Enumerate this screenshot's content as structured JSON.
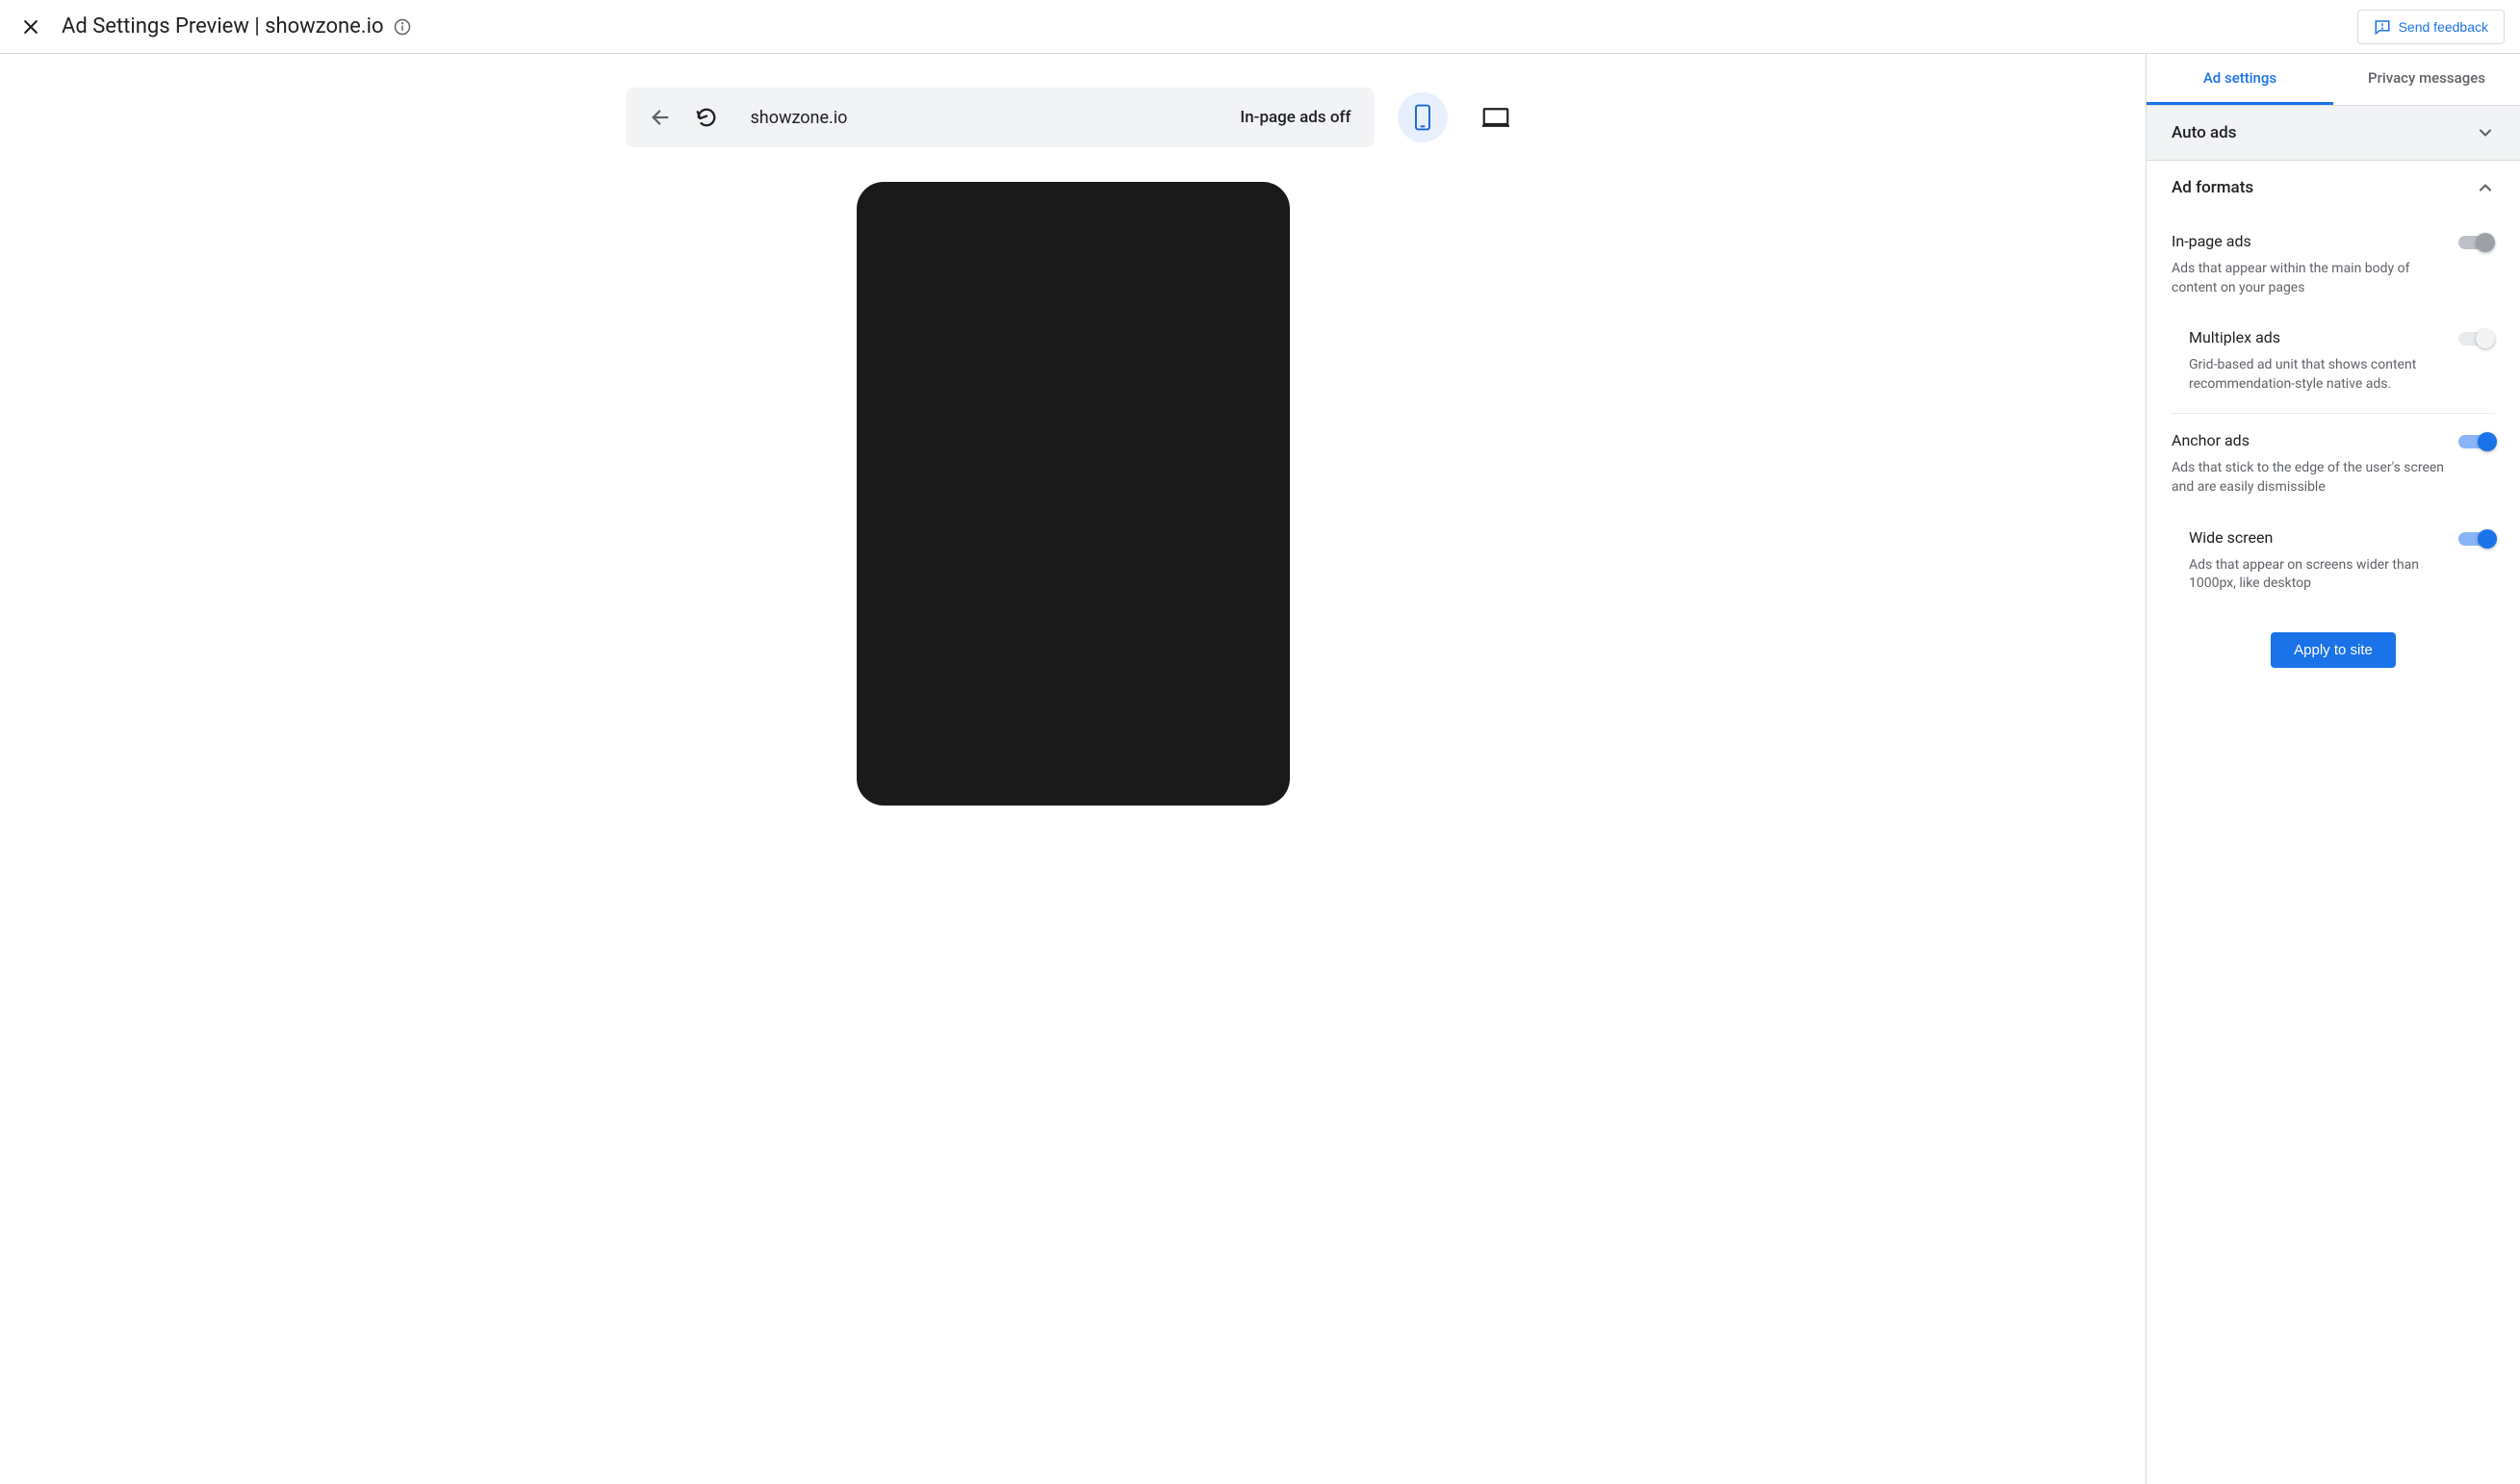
{
  "header": {
    "title": "Ad Settings Preview | showzone.io",
    "feedback_label": "Send feedback"
  },
  "preview": {
    "url": "showzone.io",
    "ads_status": "In-page ads off",
    "device_active": "mobile"
  },
  "sidebar": {
    "tabs": {
      "ad_settings": "Ad settings",
      "privacy_messages": "Privacy messages",
      "active": "ad_settings"
    },
    "auto_ads": {
      "title": "Auto ads",
      "expanded": false
    },
    "ad_formats": {
      "title": "Ad formats",
      "expanded": true,
      "in_page": {
        "title": "In-page ads",
        "desc": "Ads that appear within the main body of content on your pages",
        "enabled": false
      },
      "multiplex": {
        "title": "Multiplex ads",
        "desc": "Grid-based ad unit that shows content recommendation-style native ads.",
        "enabled": false
      },
      "anchor": {
        "title": "Anchor ads",
        "desc": "Ads that stick to the edge of the user's screen and are easily dismissible",
        "enabled": true
      },
      "wide_screen": {
        "title": "Wide screen",
        "desc": "Ads that appear on screens wider than 1000px, like desktop",
        "enabled": true
      }
    },
    "apply_label": "Apply to site"
  }
}
